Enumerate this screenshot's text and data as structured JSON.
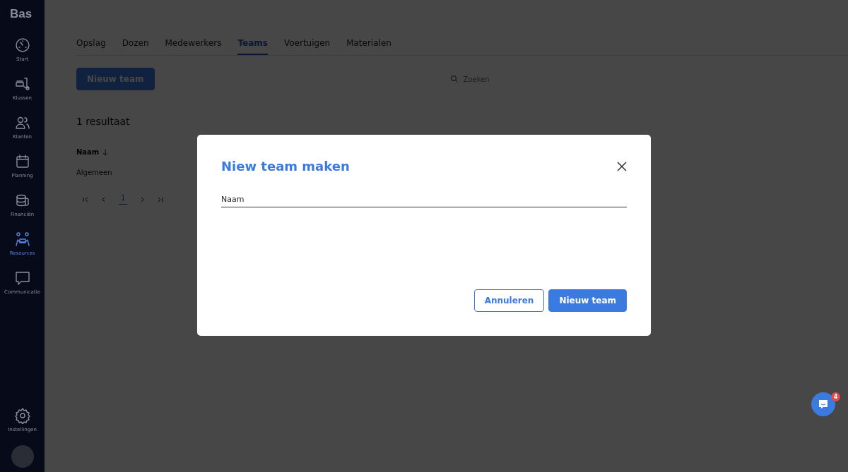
{
  "sidebar": {
    "logo": "Bas",
    "items": [
      {
        "label": "Start",
        "selected": false
      },
      {
        "label": "Klussen",
        "selected": false
      },
      {
        "label": "Klanten",
        "selected": false
      },
      {
        "label": "Planning",
        "selected": false
      },
      {
        "label": "Financiën",
        "selected": false
      },
      {
        "label": "Resources",
        "selected": true
      },
      {
        "label": "Communicatie",
        "selected": false
      }
    ],
    "settings": {
      "label": "Instellingen"
    }
  },
  "tabs": [
    {
      "label": "Opslag",
      "selected": false
    },
    {
      "label": "Dozen",
      "selected": false
    },
    {
      "label": "Medewerkers",
      "selected": false
    },
    {
      "label": "Teams",
      "selected": true
    },
    {
      "label": "Voertuigen",
      "selected": false
    },
    {
      "label": "Materialen",
      "selected": false
    }
  ],
  "new_button": "Nieuw team",
  "search": {
    "placeholder": "Zoeken"
  },
  "result_count": "1 resultaat",
  "table": {
    "columns": [
      "Naam"
    ],
    "rows": [
      [
        "Algemeen"
      ]
    ]
  },
  "pagination": {
    "pages": [
      {
        "label": "1",
        "selected": true
      }
    ]
  },
  "modal": {
    "title": "Niew team maken",
    "field": {
      "placeholder": "Naam"
    },
    "buttons": [
      {
        "label": "Annuleren",
        "kind": "secondary"
      },
      {
        "label": "Nieuw team",
        "kind": "primary"
      }
    ]
  },
  "chat": {
    "badge": "4"
  }
}
